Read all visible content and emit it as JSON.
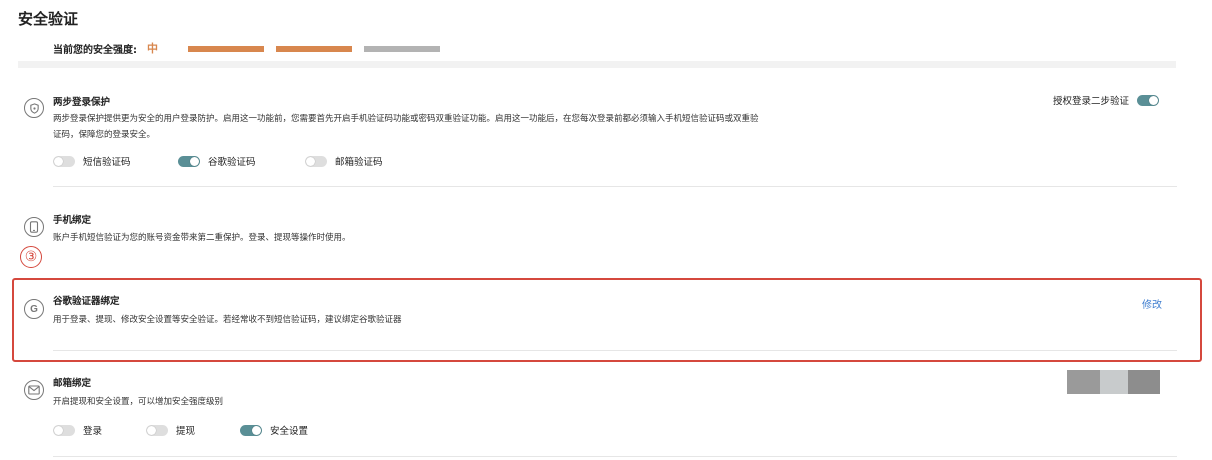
{
  "page": {
    "title": "安全验证"
  },
  "strength": {
    "label": "当前您的安全强度:",
    "level": "中",
    "levels_filled": 2,
    "levels_total": 3,
    "colors": {
      "filled": "#d8874e",
      "empty": "#b3b3b3"
    }
  },
  "sections": {
    "two_step": {
      "title": "两步登录保护",
      "desc_line1": "两步登录保护提供更为安全的用户登录防护。启用这一功能前，您需要首先开启手机验证码功能或密码双重验证功能。启用这一功能后，在您每次登录前都必须输入手机短信验证码或双重验",
      "desc_line2": "证码，保障您的登录安全。",
      "authorize_label": "授权登录二步验证",
      "authorize_on": true,
      "options": [
        {
          "label": "短信验证码",
          "on": false
        },
        {
          "label": "谷歌验证码",
          "on": true
        },
        {
          "label": "邮箱验证码",
          "on": false
        }
      ]
    },
    "phone": {
      "title": "手机绑定",
      "desc": "账户手机短信验证为您的账号资金带来第二重保护。登录、提现等操作时使用。"
    },
    "google": {
      "title": "谷歌验证器绑定",
      "desc": "用于登录、提现、修改安全设置等安全验证。若经常收不到短信验证码，建议绑定谷歌验证器",
      "action_label": "修改",
      "step_marker": "③"
    },
    "email": {
      "title": "邮箱绑定",
      "desc": "开启提现和安全设置，可以增加安全强度级别",
      "options": [
        {
          "label": "登录",
          "on": false
        },
        {
          "label": "提现",
          "on": false
        },
        {
          "label": "安全设置",
          "on": true
        }
      ]
    }
  },
  "colors": {
    "accent": "#5a8f96",
    "link": "#3f7ed0",
    "highlight": "#d5483d",
    "strength": "#d8874e"
  },
  "icons": {
    "two_step": "shield-icon",
    "phone": "phone-icon",
    "google": "google-g-icon",
    "email": "envelope-icon"
  }
}
